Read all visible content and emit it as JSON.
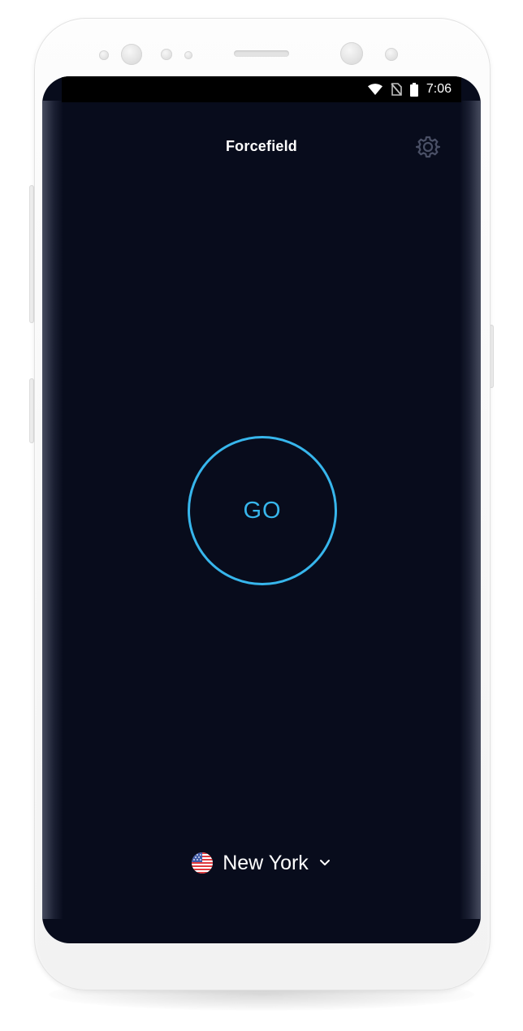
{
  "status_bar": {
    "time": "7:06",
    "icons": [
      "wifi-icon",
      "no-sim-icon",
      "battery-icon"
    ]
  },
  "app": {
    "title": "Forcefield",
    "settings_icon": "gear-icon"
  },
  "connect_button": {
    "label": "GO",
    "color": "#37b6ec"
  },
  "location": {
    "name": "New York",
    "flag_icon": "us-flag-icon",
    "dropdown_icon": "chevron-down-icon"
  },
  "colors": {
    "background": "#080c1c",
    "accent": "#37b6ec",
    "text": "#ffffff",
    "icon_muted": "#4a5066"
  }
}
